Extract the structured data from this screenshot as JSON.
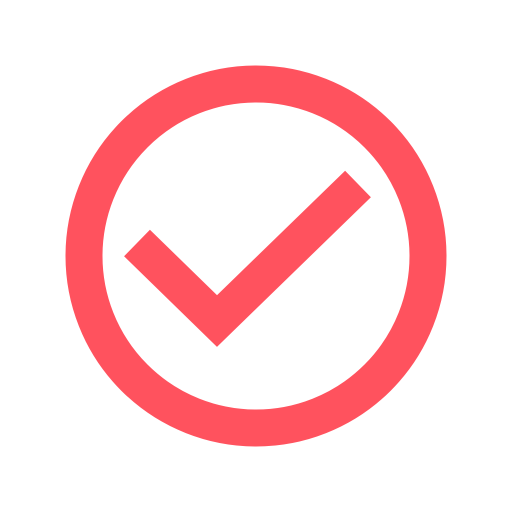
{
  "icon": {
    "name": "checkmark-circle-icon",
    "color": "#FF525E",
    "background": "#FFFFFF"
  }
}
